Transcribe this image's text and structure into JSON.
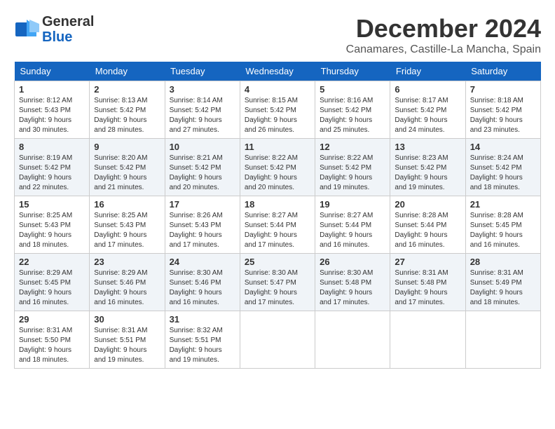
{
  "header": {
    "logo_line1": "General",
    "logo_line2": "Blue",
    "month_title": "December 2024",
    "location": "Canamares, Castille-La Mancha, Spain"
  },
  "days_of_week": [
    "Sunday",
    "Monday",
    "Tuesday",
    "Wednesday",
    "Thursday",
    "Friday",
    "Saturday"
  ],
  "weeks": [
    [
      {
        "day": "1",
        "sunrise": "Sunrise: 8:12 AM",
        "sunset": "Sunset: 5:43 PM",
        "daylight": "Daylight: 9 hours and 30 minutes."
      },
      {
        "day": "2",
        "sunrise": "Sunrise: 8:13 AM",
        "sunset": "Sunset: 5:42 PM",
        "daylight": "Daylight: 9 hours and 28 minutes."
      },
      {
        "day": "3",
        "sunrise": "Sunrise: 8:14 AM",
        "sunset": "Sunset: 5:42 PM",
        "daylight": "Daylight: 9 hours and 27 minutes."
      },
      {
        "day": "4",
        "sunrise": "Sunrise: 8:15 AM",
        "sunset": "Sunset: 5:42 PM",
        "daylight": "Daylight: 9 hours and 26 minutes."
      },
      {
        "day": "5",
        "sunrise": "Sunrise: 8:16 AM",
        "sunset": "Sunset: 5:42 PM",
        "daylight": "Daylight: 9 hours and 25 minutes."
      },
      {
        "day": "6",
        "sunrise": "Sunrise: 8:17 AM",
        "sunset": "Sunset: 5:42 PM",
        "daylight": "Daylight: 9 hours and 24 minutes."
      },
      {
        "day": "7",
        "sunrise": "Sunrise: 8:18 AM",
        "sunset": "Sunset: 5:42 PM",
        "daylight": "Daylight: 9 hours and 23 minutes."
      }
    ],
    [
      {
        "day": "8",
        "sunrise": "Sunrise: 8:19 AM",
        "sunset": "Sunset: 5:42 PM",
        "daylight": "Daylight: 9 hours and 22 minutes."
      },
      {
        "day": "9",
        "sunrise": "Sunrise: 8:20 AM",
        "sunset": "Sunset: 5:42 PM",
        "daylight": "Daylight: 9 hours and 21 minutes."
      },
      {
        "day": "10",
        "sunrise": "Sunrise: 8:21 AM",
        "sunset": "Sunset: 5:42 PM",
        "daylight": "Daylight: 9 hours and 20 minutes."
      },
      {
        "day": "11",
        "sunrise": "Sunrise: 8:22 AM",
        "sunset": "Sunset: 5:42 PM",
        "daylight": "Daylight: 9 hours and 20 minutes."
      },
      {
        "day": "12",
        "sunrise": "Sunrise: 8:22 AM",
        "sunset": "Sunset: 5:42 PM",
        "daylight": "Daylight: 9 hours and 19 minutes."
      },
      {
        "day": "13",
        "sunrise": "Sunrise: 8:23 AM",
        "sunset": "Sunset: 5:42 PM",
        "daylight": "Daylight: 9 hours and 19 minutes."
      },
      {
        "day": "14",
        "sunrise": "Sunrise: 8:24 AM",
        "sunset": "Sunset: 5:42 PM",
        "daylight": "Daylight: 9 hours and 18 minutes."
      }
    ],
    [
      {
        "day": "15",
        "sunrise": "Sunrise: 8:25 AM",
        "sunset": "Sunset: 5:43 PM",
        "daylight": "Daylight: 9 hours and 18 minutes."
      },
      {
        "day": "16",
        "sunrise": "Sunrise: 8:25 AM",
        "sunset": "Sunset: 5:43 PM",
        "daylight": "Daylight: 9 hours and 17 minutes."
      },
      {
        "day": "17",
        "sunrise": "Sunrise: 8:26 AM",
        "sunset": "Sunset: 5:43 PM",
        "daylight": "Daylight: 9 hours and 17 minutes."
      },
      {
        "day": "18",
        "sunrise": "Sunrise: 8:27 AM",
        "sunset": "Sunset: 5:44 PM",
        "daylight": "Daylight: 9 hours and 17 minutes."
      },
      {
        "day": "19",
        "sunrise": "Sunrise: 8:27 AM",
        "sunset": "Sunset: 5:44 PM",
        "daylight": "Daylight: 9 hours and 16 minutes."
      },
      {
        "day": "20",
        "sunrise": "Sunrise: 8:28 AM",
        "sunset": "Sunset: 5:44 PM",
        "daylight": "Daylight: 9 hours and 16 minutes."
      },
      {
        "day": "21",
        "sunrise": "Sunrise: 8:28 AM",
        "sunset": "Sunset: 5:45 PM",
        "daylight": "Daylight: 9 hours and 16 minutes."
      }
    ],
    [
      {
        "day": "22",
        "sunrise": "Sunrise: 8:29 AM",
        "sunset": "Sunset: 5:45 PM",
        "daylight": "Daylight: 9 hours and 16 minutes."
      },
      {
        "day": "23",
        "sunrise": "Sunrise: 8:29 AM",
        "sunset": "Sunset: 5:46 PM",
        "daylight": "Daylight: 9 hours and 16 minutes."
      },
      {
        "day": "24",
        "sunrise": "Sunrise: 8:30 AM",
        "sunset": "Sunset: 5:46 PM",
        "daylight": "Daylight: 9 hours and 16 minutes."
      },
      {
        "day": "25",
        "sunrise": "Sunrise: 8:30 AM",
        "sunset": "Sunset: 5:47 PM",
        "daylight": "Daylight: 9 hours and 17 minutes."
      },
      {
        "day": "26",
        "sunrise": "Sunrise: 8:30 AM",
        "sunset": "Sunset: 5:48 PM",
        "daylight": "Daylight: 9 hours and 17 minutes."
      },
      {
        "day": "27",
        "sunrise": "Sunrise: 8:31 AM",
        "sunset": "Sunset: 5:48 PM",
        "daylight": "Daylight: 9 hours and 17 minutes."
      },
      {
        "day": "28",
        "sunrise": "Sunrise: 8:31 AM",
        "sunset": "Sunset: 5:49 PM",
        "daylight": "Daylight: 9 hours and 18 minutes."
      }
    ],
    [
      {
        "day": "29",
        "sunrise": "Sunrise: 8:31 AM",
        "sunset": "Sunset: 5:50 PM",
        "daylight": "Daylight: 9 hours and 18 minutes."
      },
      {
        "day": "30",
        "sunrise": "Sunrise: 8:31 AM",
        "sunset": "Sunset: 5:51 PM",
        "daylight": "Daylight: 9 hours and 19 minutes."
      },
      {
        "day": "31",
        "sunrise": "Sunrise: 8:32 AM",
        "sunset": "Sunset: 5:51 PM",
        "daylight": "Daylight: 9 hours and 19 minutes."
      },
      null,
      null,
      null,
      null
    ]
  ]
}
